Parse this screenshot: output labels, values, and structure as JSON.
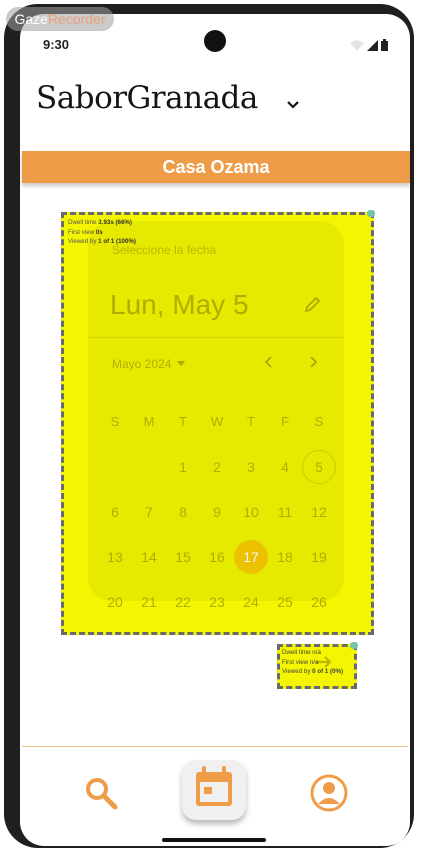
{
  "watermark": {
    "part1": "Gaze",
    "part2": "Recorder"
  },
  "status_bar": {
    "time": "9:30",
    "icons": [
      "wifi-icon",
      "signal-icon",
      "battery-icon"
    ]
  },
  "header": {
    "title": "SaborGranada",
    "dropdown_icon": "chevron-down-icon"
  },
  "banner": {
    "title": "Casa Ozama"
  },
  "colors": {
    "accent": "#ef9c49",
    "overlay": "#f4f500",
    "selected_day": "#ecc100"
  },
  "heatmap_overlay_1": {
    "dwell_label": "Dwell time",
    "dwell_value": "3.93s (66%)",
    "first_view_label": "First view",
    "first_view_value": "0s",
    "viewed_label": "Viewed by",
    "viewed_value": "1 of 1 (100%)"
  },
  "heatmap_overlay_2": {
    "dwell_label": "Dwell time",
    "dwell_value": "n/a",
    "first_view_label": "First view",
    "first_view_value": "n/a",
    "viewed_label": "Viewed by",
    "viewed_value": "0 of 1 (0%)"
  },
  "date_picker": {
    "label": "Seleccione la fecha",
    "selected_date": "Lun, May 5",
    "month_year": "Mayo 2024",
    "weekdays": [
      "S",
      "M",
      "T",
      "W",
      "T",
      "F",
      "S"
    ],
    "weeks": [
      [
        "",
        "",
        "1",
        "2",
        "3",
        "4",
        "5"
      ],
      [
        "6",
        "7",
        "8",
        "9",
        "10",
        "11",
        "12"
      ],
      [
        "13",
        "14",
        "15",
        "16",
        "17",
        "18",
        "19"
      ],
      [
        "20",
        "21",
        "22",
        "23",
        "24",
        "25",
        "26"
      ]
    ],
    "today_day": "5",
    "highlighted_day": "17"
  },
  "bottom_nav": {
    "items": [
      "search-icon",
      "calendar-icon",
      "profile-icon"
    ]
  }
}
